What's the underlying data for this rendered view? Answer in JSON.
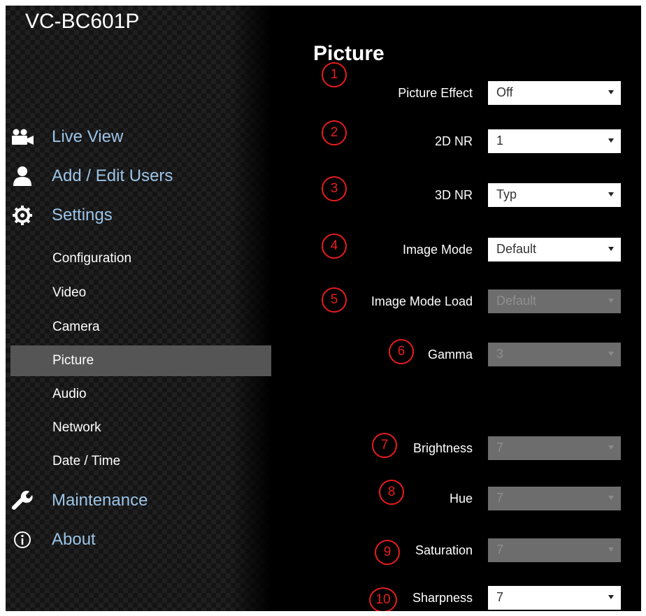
{
  "device_title": "VC-BC601P",
  "page_title": "Picture",
  "nav": {
    "live_view": "Live View",
    "add_edit_users": "Add / Edit Users",
    "settings": "Settings",
    "maintenance": "Maintenance",
    "about": "About",
    "settings_items": [
      "Configuration",
      "Video",
      "Camera",
      "Picture",
      "Audio",
      "Network",
      "Date / Time"
    ],
    "active_item": "Picture",
    "label_color": "#9cc4e8"
  },
  "fields": [
    {
      "marker": "1",
      "label": "Picture Effect",
      "value": "Off",
      "enabled": true
    },
    {
      "marker": "2",
      "label": "2D NR",
      "value": "1",
      "enabled": true
    },
    {
      "marker": "3",
      "label": "3D NR",
      "value": "Typ",
      "enabled": true
    },
    {
      "marker": "4",
      "label": "Image Mode",
      "value": "Default",
      "enabled": true
    },
    {
      "marker": "5",
      "label": "Image Mode Load",
      "value": "Default",
      "enabled": false
    },
    {
      "marker": "6",
      "label": "Gamma",
      "value": "3",
      "enabled": false
    },
    {
      "marker": "7",
      "label": "Brightness",
      "value": "7",
      "enabled": false
    },
    {
      "marker": "8",
      "label": "Hue",
      "value": "7",
      "enabled": false
    },
    {
      "marker": "9",
      "label": "Saturation",
      "value": "7",
      "enabled": false
    },
    {
      "marker": "10",
      "label": "Sharpness",
      "value": "7",
      "enabled": true
    }
  ],
  "colors": {
    "marker": "#e81c1c",
    "active_row": "#555555",
    "disabled_select": "#6d6d6d"
  }
}
